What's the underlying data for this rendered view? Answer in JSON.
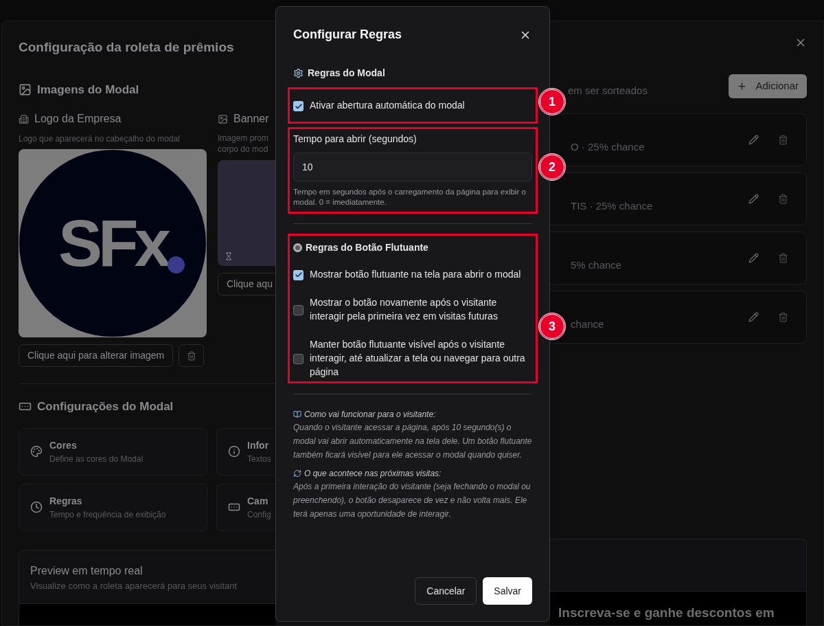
{
  "page": {
    "title": "Configuração da roleta de prêmios",
    "images_section": {
      "title": "Imagens do Modal",
      "logo": {
        "label": "Logo da Empresa",
        "hint": "Logo que aparecerá no cabeçalho do modal",
        "logo_text": "SFx",
        "button": "Clique aqui para alterar imagem"
      },
      "banner": {
        "label": "Banner",
        "hint_lines": [
          "Imagem prom",
          "corpo do mod"
        ],
        "button": "Clique aqu"
      }
    },
    "settings_section": {
      "title": "Configurações do Modal",
      "cards": [
        {
          "kind": "palette",
          "title": "Cores",
          "subtitle": "Define as cores do Modal"
        },
        {
          "kind": "info",
          "title": "Infor",
          "subtitle": "Textos"
        },
        {
          "kind": "clock",
          "title": "Regras",
          "subtitle": "Tempo e frequência de exibição"
        },
        {
          "kind": "form",
          "title": "Cam",
          "subtitle": "Config"
        }
      ]
    },
    "preview": {
      "title": "Preview em tempo real",
      "subtitle": "Visualize como a roleta aparecerá para seus visitant",
      "headline": "Inscreva-se e ganhe descontos em"
    },
    "prizes": {
      "subtitle": "em ser sorteados",
      "add_button": "Adicionar",
      "items": [
        {
          "detail": "O · 25% chance"
        },
        {
          "detail": "TIS · 25% chance"
        },
        {
          "detail": "5% chance"
        },
        {
          "detail": "chance"
        }
      ]
    }
  },
  "dialog": {
    "title": "Configurar Regras",
    "modal_rules": {
      "heading": "Regras do Modal",
      "auto_open": {
        "label": "Ativar abertura automática do modal",
        "checked": true
      },
      "delay": {
        "label": "Tempo para abrir (segundos)",
        "value": "10",
        "help": "Tempo em segundos após o carregamento da página para exibir o modal. 0 = imediatamente."
      }
    },
    "floating_rules": {
      "heading": "Regras do Botão Flutuante",
      "options": [
        {
          "label": "Mostrar botão flutuante na tela para abrir o modal",
          "checked": true
        },
        {
          "label": "Mostrar o botão novamente após o visitante interagir pela primeira vez em visitas futuras",
          "checked": false
        },
        {
          "label": "Manter botão flutuante visível após o visitante interagir, até atualizar a tela ou navegar para outra página",
          "checked": false
        }
      ]
    },
    "info": [
      {
        "kind": "book",
        "heading": "Como vai funcionar para o visitante:",
        "text": "Quando o visitante acessar a página, após 10 segundo(s) o modal vai abrir automaticamente na tela dele. Um botão flutuante também ficará visível para ele acessar o modal quando quiser."
      },
      {
        "kind": "repeat",
        "heading": "O que acontece nas próximas visitas:",
        "text": "Após a primeira interação do visitante (seja fechando o modal ou preenchendo), o botão desaparece de vez e não volta mais. Ele terá apenas uma oportunidade de interagir."
      }
    ],
    "buttons": {
      "cancel": "Cancelar",
      "save": "Salvar"
    }
  },
  "annotations": [
    {
      "number": "1"
    },
    {
      "number": "2"
    },
    {
      "number": "3"
    }
  ]
}
